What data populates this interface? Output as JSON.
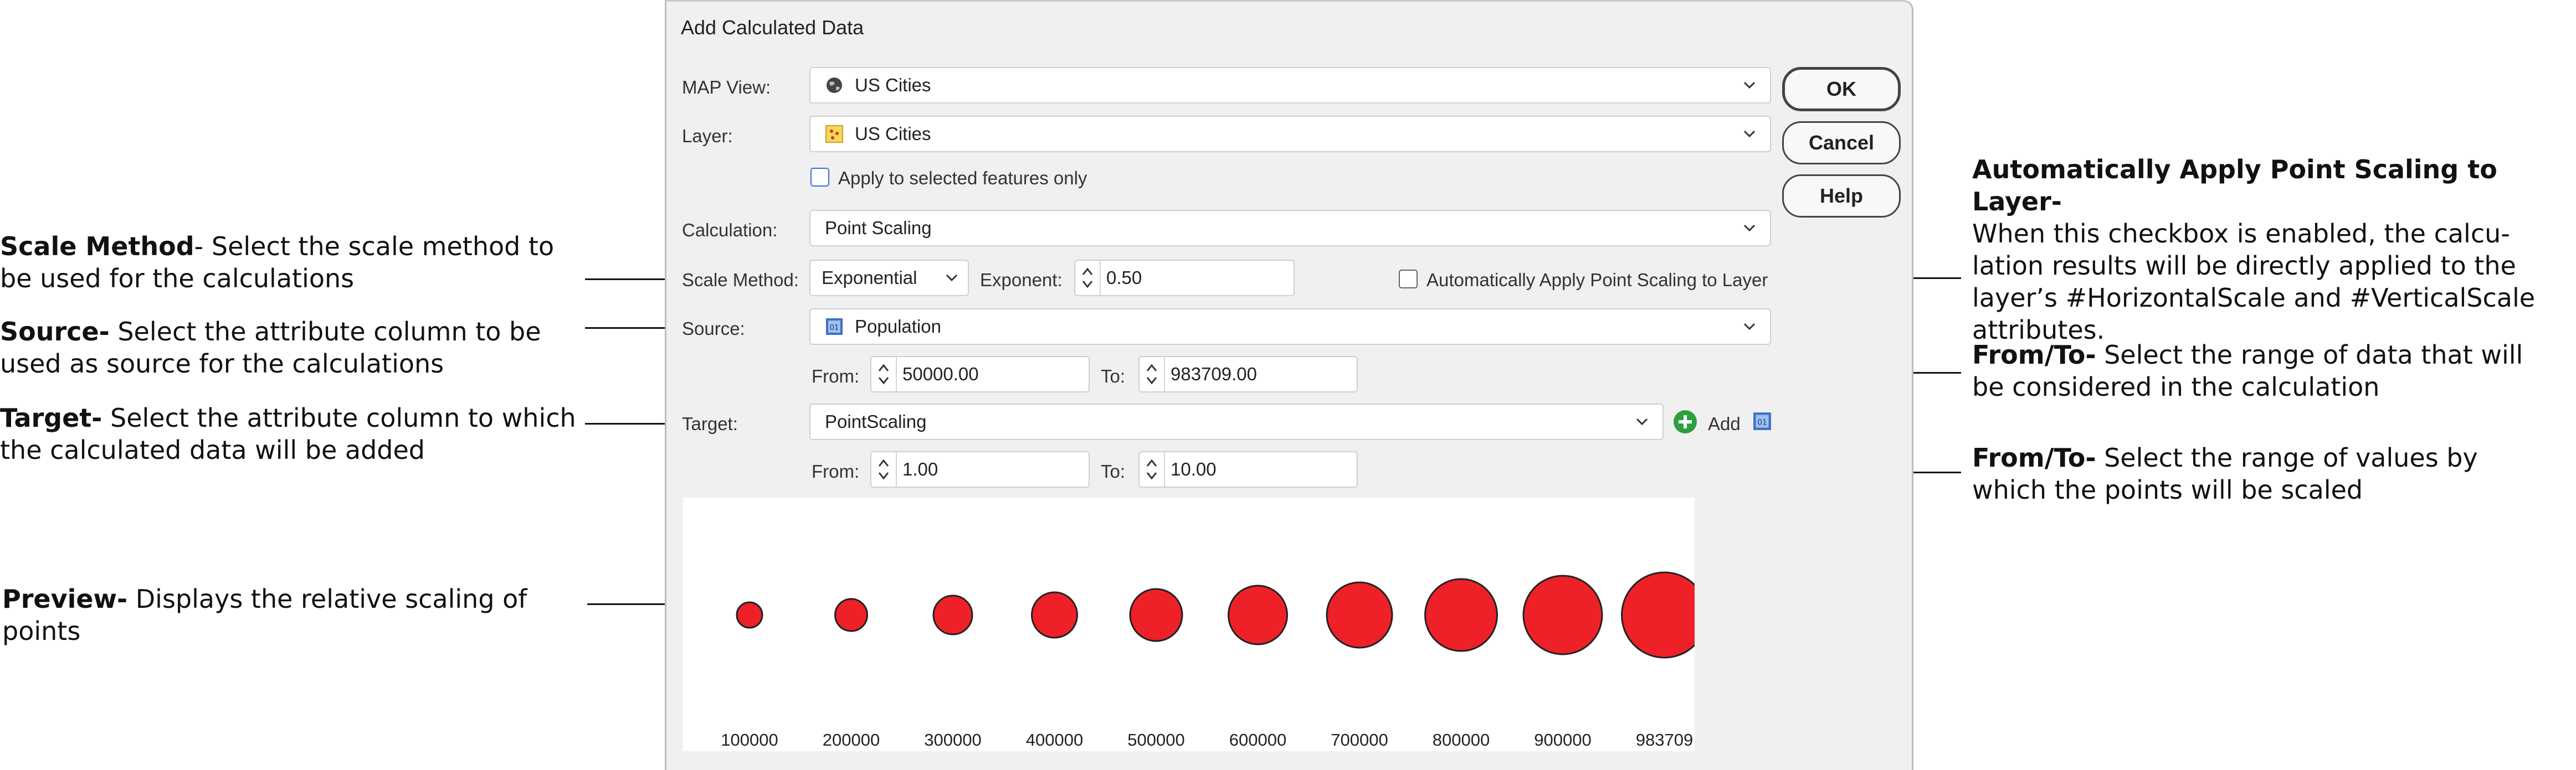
{
  "dialog": {
    "title": "Add Calculated Data",
    "map_view": {
      "label": "MAP View:",
      "value": "US Cities",
      "icon": "globe-icon"
    },
    "layer": {
      "label": "Layer:",
      "value": "US Cities",
      "icon": "point-layer-icon"
    },
    "selected_only": {
      "label": "Apply to selected features only",
      "checked": false
    },
    "calculation": {
      "label": "Calculation:",
      "value": "Point Scaling"
    },
    "scale_method": {
      "label": "Scale Method:",
      "value": "Exponential"
    },
    "exponent": {
      "label": "Exponent:",
      "value": "0.50"
    },
    "auto_apply": {
      "label": "Automatically Apply Point Scaling to Layer",
      "checked": false
    },
    "source": {
      "label": "Source:",
      "value": "Population",
      "from_label": "From:",
      "from": "50000.00",
      "to_label": "To:",
      "to": "983709.00"
    },
    "target": {
      "label": "Target:",
      "value": "PointScaling",
      "add_label": "Add",
      "from_label": "From:",
      "from": "1.00",
      "to_label": "To:",
      "to": "10.00"
    },
    "buttons": {
      "ok": "OK",
      "cancel": "Cancel",
      "help": "Help"
    },
    "colors": {
      "point_fill": "#ee2028",
      "point_stroke": "#222222",
      "add_green": "#2e9e3e"
    }
  },
  "chart_data": {
    "type": "scatter",
    "categories": [
      "100000",
      "200000",
      "300000",
      "400000",
      "500000",
      "600000",
      "700000",
      "800000",
      "900000",
      "983709"
    ],
    "values": [
      1.0,
      2.0,
      3.0,
      4.0,
      5.0,
      6.0,
      7.0,
      8.0,
      9.0,
      10.0
    ]
  },
  "annotations": {
    "scale_method": {
      "title": "Scale Method",
      "text": "- Select the scale method to be used for the calculations"
    },
    "source": {
      "title": "Source-",
      "text": " Select the attribute column to be used as source for the calculations"
    },
    "target": {
      "title": "Target-",
      "text": " Select the attribute column to which the calculated data will be added"
    },
    "preview": {
      "title": "Preview-",
      "text": "  Displays the relative scaling of points"
    },
    "auto_apply": {
      "title": "Automatically Apply Point Scaling to Layer-",
      "text": "When this checkbox is enabled, the calcu-lation results will be directly applied to the layer’s #HorizontalScale and #VerticalScale attributes."
    },
    "source_range": {
      "title": "From/To-",
      "text": " Select the range of data that will be considered in the calculation"
    },
    "target_range": {
      "title": "From/To-",
      "text": " Select the range of values by which the points will be scaled"
    }
  }
}
